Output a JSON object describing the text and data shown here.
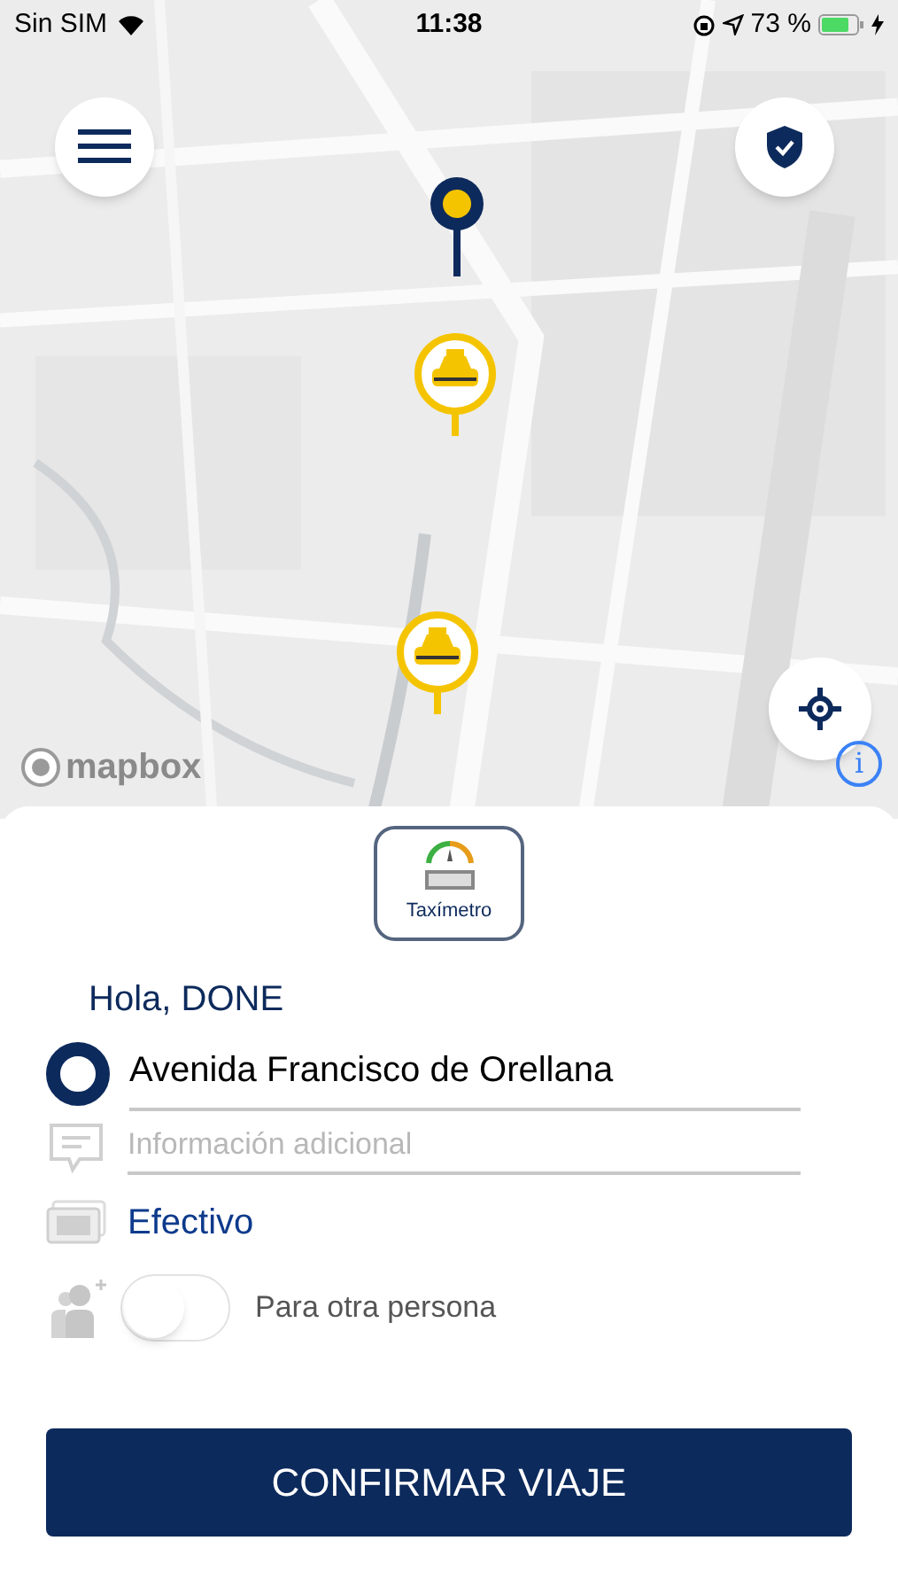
{
  "status_bar": {
    "carrier": "Sin SIM",
    "time": "11:38",
    "battery": "73 %"
  },
  "map": {
    "attribution": "mapbox",
    "info": "i"
  },
  "taximeter": {
    "label": "Taxímetro"
  },
  "greeting": "Hola, DONE",
  "origin": {
    "value": "Avenida Francisco de Orellana"
  },
  "note": {
    "placeholder": "Información adicional"
  },
  "payment": {
    "label": "Efectivo"
  },
  "other_person": {
    "label": "Para otra persona",
    "on": false
  },
  "confirm_button": "CONFIRMAR VIAJE"
}
